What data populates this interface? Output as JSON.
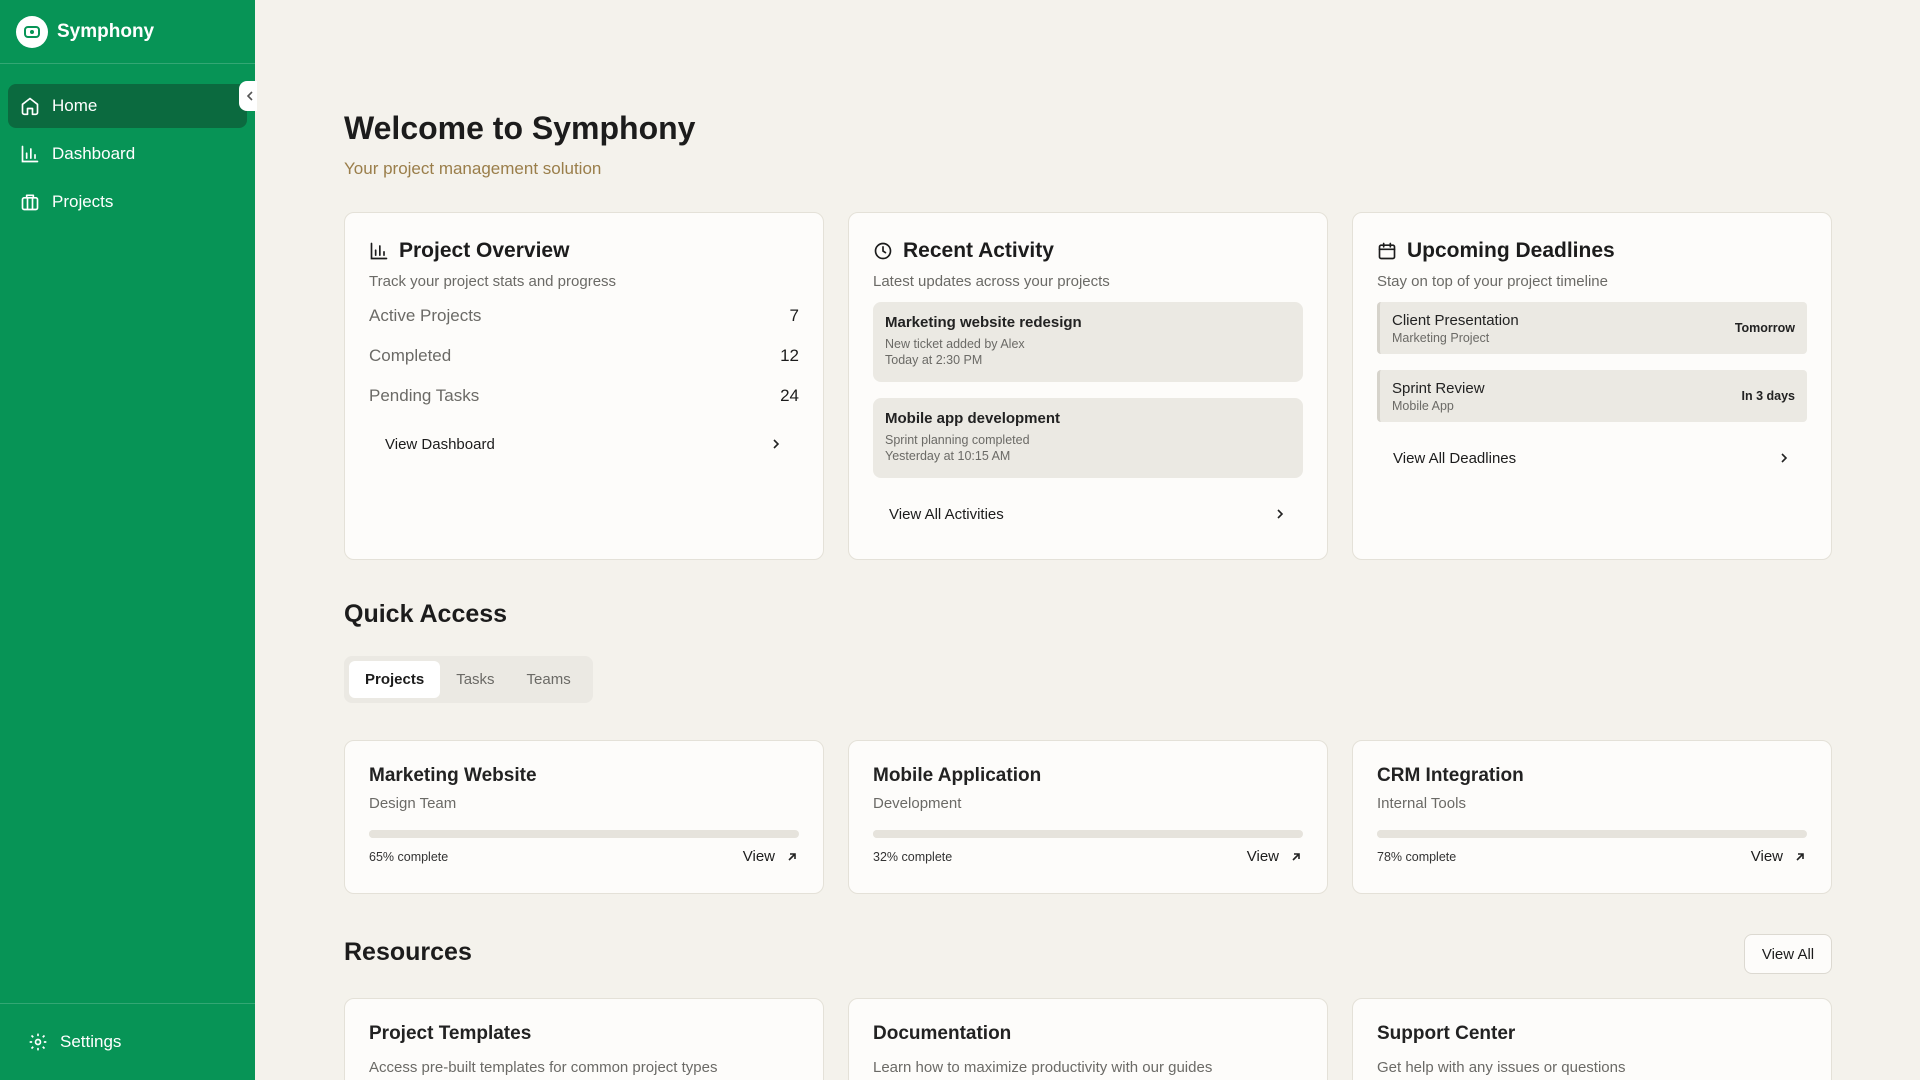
{
  "app": {
    "name": "Symphony"
  },
  "sidebar": {
    "items": [
      {
        "label": "Home",
        "icon": "home-icon"
      },
      {
        "label": "Dashboard",
        "icon": "bar-chart-icon"
      },
      {
        "label": "Projects",
        "icon": "briefcase-icon"
      }
    ],
    "footer": {
      "label": "Settings",
      "icon": "gear-icon"
    }
  },
  "header": {
    "title": "Welcome to Symphony",
    "subtitle": "Your project management solution"
  },
  "overview": {
    "title": "Project Overview",
    "desc": "Track your project stats and progress",
    "stats": [
      {
        "label": "Active Projects",
        "value": "7"
      },
      {
        "label": "Completed",
        "value": "12"
      },
      {
        "label": "Pending Tasks",
        "value": "24"
      }
    ],
    "link": "View Dashboard"
  },
  "activity": {
    "title": "Recent Activity",
    "desc": "Latest updates across your projects",
    "items": [
      {
        "title": "Marketing website redesign",
        "detail": "New ticket added by Alex",
        "time": "Today at 2:30 PM"
      },
      {
        "title": "Mobile app development",
        "detail": "Sprint planning completed",
        "time": "Yesterday at 10:15 AM"
      }
    ],
    "link": "View All Activities"
  },
  "deadlines": {
    "title": "Upcoming Deadlines",
    "desc": "Stay on top of your project timeline",
    "items": [
      {
        "title": "Client Presentation",
        "project": "Marketing Project",
        "when": "Tomorrow"
      },
      {
        "title": "Sprint Review",
        "project": "Mobile App",
        "when": "In 3 days"
      }
    ],
    "link": "View All Deadlines"
  },
  "quick_access": {
    "title": "Quick Access",
    "tabs": [
      "Projects",
      "Tasks",
      "Teams"
    ],
    "active_tab": "Projects",
    "projects": [
      {
        "title": "Marketing Website",
        "team": "Design Team",
        "progress": 0.65,
        "progress_label": "65% complete",
        "action": "View"
      },
      {
        "title": "Mobile Application",
        "team": "Development",
        "progress": 0.32,
        "progress_label": "32% complete",
        "action": "View"
      },
      {
        "title": "CRM Integration",
        "team": "Internal Tools",
        "progress": 0.78,
        "progress_label": "78% complete",
        "action": "View"
      }
    ]
  },
  "resources": {
    "title": "Resources",
    "view_all": "View All",
    "items": [
      {
        "title": "Project Templates",
        "desc": "Access pre-built templates for common project types"
      },
      {
        "title": "Documentation",
        "desc": "Learn how to maximize productivity with our guides"
      },
      {
        "title": "Support Center",
        "desc": "Get help with any issues or questions"
      }
    ]
  },
  "colors": {
    "sidebar": "#079456",
    "sidebar_active": "#0b6a3f",
    "background": "#f4f2ec",
    "subtitle": "#9a7e4a"
  }
}
